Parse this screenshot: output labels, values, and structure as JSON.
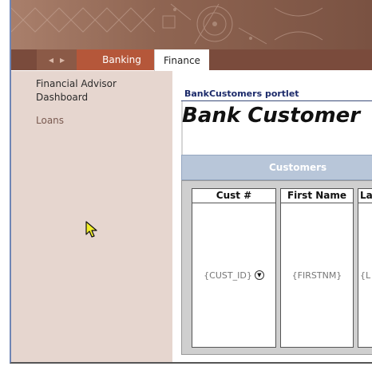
{
  "tabs": {
    "banking_label": "Banking",
    "finance_label": "Finance"
  },
  "sidebar": {
    "items": [
      {
        "label": "Financial Advisor Dashboard"
      },
      {
        "label": "Loans"
      }
    ]
  },
  "portlet": {
    "header": "BankCustomers portlet",
    "title": "Bank Customer",
    "panel_title": "Customers"
  },
  "table": {
    "columns": [
      {
        "header": "Cust #",
        "cell": "{CUST_ID}"
      },
      {
        "header": "First Name",
        "cell": "{FIRSTNM}"
      },
      {
        "header": "La",
        "cell": "{L"
      }
    ]
  },
  "colors": {
    "tab_active": "#b5573a",
    "tab_bar": "#7a4b3c",
    "sidebar_bg": "#e6d6cf",
    "panel_header": "#b8c6d9",
    "portlet_title": "#1c2a6a"
  },
  "icons": {
    "tab_scroll": "arrow-left-right-icon",
    "cell_dropdown": "chevron-down-circle-icon",
    "pointer": "mouse-cursor-icon"
  }
}
